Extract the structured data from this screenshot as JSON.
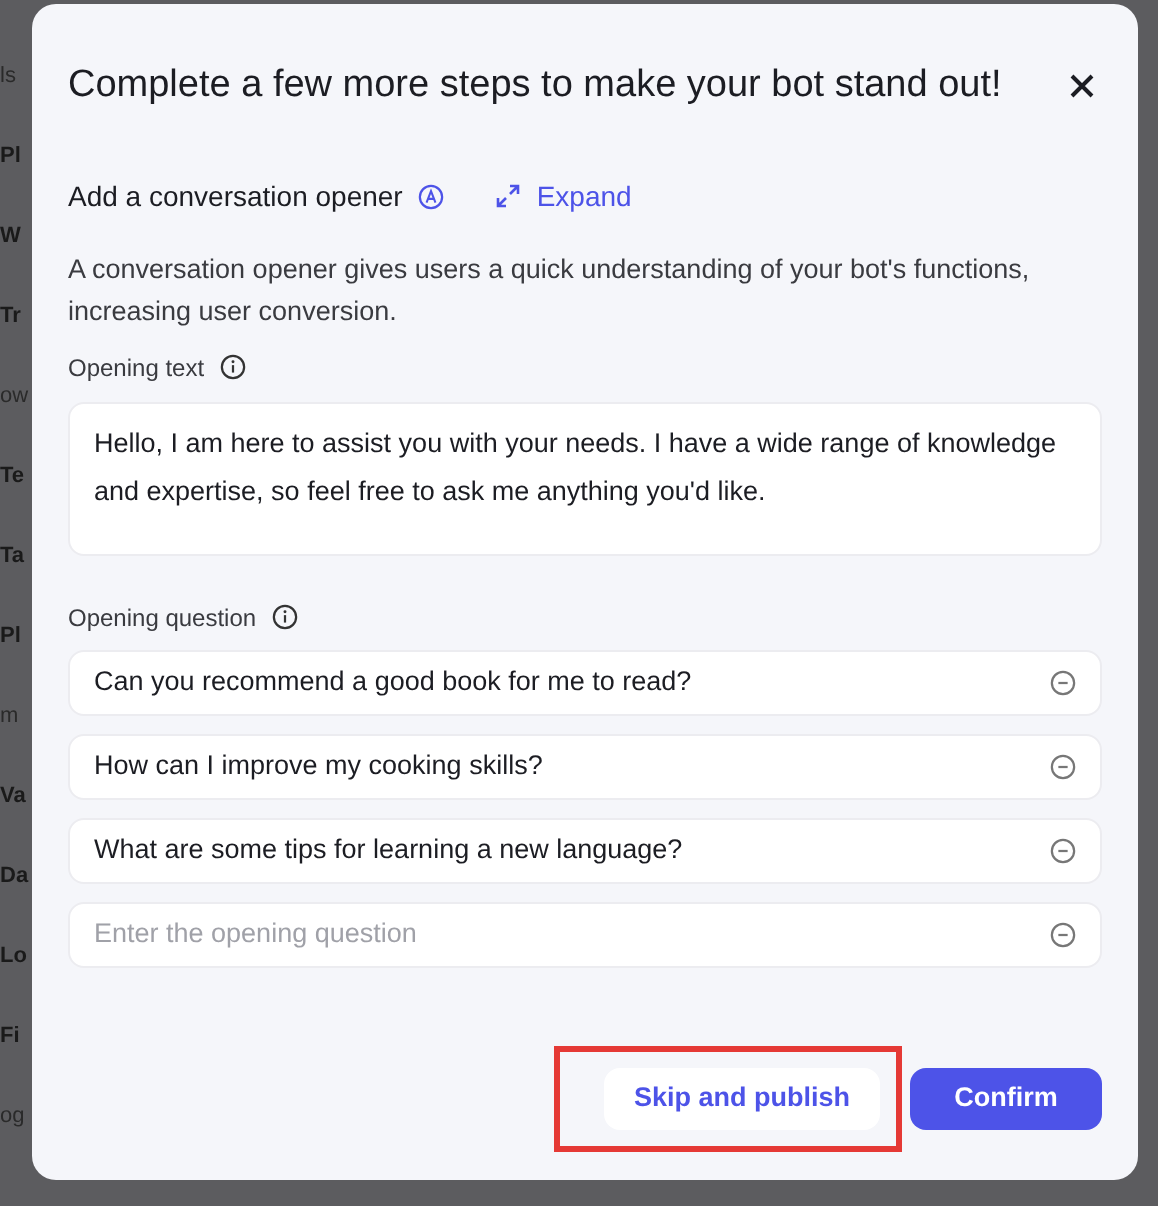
{
  "background_items": [
    {
      "label": "ls",
      "kind": "muted"
    },
    {
      "label": "Pl",
      "kind": "item"
    },
    {
      "label": "W",
      "kind": "item"
    },
    {
      "label": "Tr",
      "kind": "item"
    },
    {
      "label": "ow",
      "kind": "muted"
    },
    {
      "label": "Te",
      "kind": "item"
    },
    {
      "label": "Ta",
      "kind": "item"
    },
    {
      "label": "Pl",
      "kind": "item"
    },
    {
      "label": "m",
      "kind": "muted"
    },
    {
      "label": "Va",
      "kind": "item"
    },
    {
      "label": "Da",
      "kind": "item"
    },
    {
      "label": "Lo",
      "kind": "item"
    },
    {
      "label": "Fi",
      "kind": "item"
    },
    {
      "label": "og",
      "kind": "muted"
    }
  ],
  "dialog": {
    "title": "Complete a few more steps to make your bot stand out!",
    "section_title": "Add a conversation opener",
    "expand": "Expand",
    "description": "A conversation opener gives users a quick understanding of your bot's functions, increasing user conversion.",
    "opening_text_label": "Opening text",
    "opening_text": "Hello, I am here to assist you with your needs. I have a wide range of knowledge and expertise, so feel free to ask me anything you'd like.",
    "opening_question_label": "Opening question",
    "questions": [
      {
        "value": "Can you recommend a good book for me to read?"
      },
      {
        "value": "How can I improve my cooking skills?"
      },
      {
        "value": "What are some tips for learning a new language?"
      },
      {
        "placeholder": "Enter the opening question"
      }
    ],
    "buttons": [
      {
        "label": "Skip and publish",
        "kind": "secondary",
        "highlighted": true
      },
      {
        "label": "Confirm",
        "kind": "primary",
        "highlighted": false
      }
    ]
  }
}
